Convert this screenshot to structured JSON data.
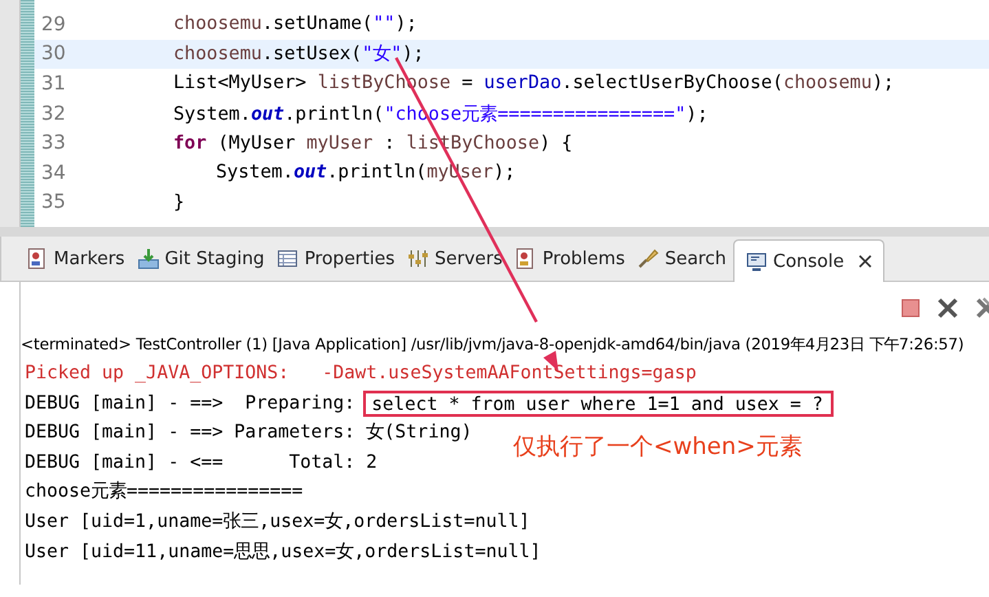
{
  "editor": {
    "lines": [
      {
        "number": "29",
        "current": false,
        "tokens": [
          {
            "kind": "var",
            "text": "choosemu"
          },
          {
            "kind": "plain",
            "text": ".setUname("
          },
          {
            "kind": "string",
            "text": "\"\""
          },
          {
            "kind": "plain",
            "text": ");"
          }
        ]
      },
      {
        "number": "30",
        "current": true,
        "tokens": [
          {
            "kind": "var",
            "text": "choosemu"
          },
          {
            "kind": "plain",
            "text": ".setUsex("
          },
          {
            "kind": "string",
            "text": "\"女\""
          },
          {
            "kind": "plain",
            "text": ");"
          }
        ]
      },
      {
        "number": "31",
        "current": false,
        "tokens": [
          {
            "kind": "plain",
            "text": "List<MyUser> "
          },
          {
            "kind": "var",
            "text": "listByChoose"
          },
          {
            "kind": "plain",
            "text": " = "
          },
          {
            "kind": "field",
            "text": "userDao"
          },
          {
            "kind": "plain",
            "text": ".selectUserByChoose("
          },
          {
            "kind": "var",
            "text": "choosemu"
          },
          {
            "kind": "plain",
            "text": ");"
          }
        ]
      },
      {
        "number": "32",
        "current": false,
        "tokens": [
          {
            "kind": "plain",
            "text": "System."
          },
          {
            "kind": "static",
            "text": "out"
          },
          {
            "kind": "plain",
            "text": ".println("
          },
          {
            "kind": "string",
            "text": "\"choose元素================\""
          },
          {
            "kind": "plain",
            "text": ");"
          }
        ]
      },
      {
        "number": "33",
        "current": false,
        "tokens": [
          {
            "kind": "keyword",
            "text": "for"
          },
          {
            "kind": "plain",
            "text": " (MyUser "
          },
          {
            "kind": "var",
            "text": "myUser"
          },
          {
            "kind": "plain",
            "text": " : "
          },
          {
            "kind": "var",
            "text": "listByChoose"
          },
          {
            "kind": "plain",
            "text": ") {"
          }
        ],
        "children": [
          {
            "number": "34",
            "current": false,
            "tokens": [
              {
                "kind": "plain",
                "text": "System."
              },
              {
                "kind": "static",
                "text": "out"
              },
              {
                "kind": "plain",
                "text": ".println("
              },
              {
                "kind": "var",
                "text": "myUser"
              },
              {
                "kind": "plain",
                "text": ");"
              }
            ]
          }
        ]
      },
      {
        "number": "35",
        "current": false,
        "tokens": [
          {
            "kind": "plain",
            "text": "}"
          }
        ]
      }
    ]
  },
  "tabs": [
    {
      "label": "Markers",
      "selected": false
    },
    {
      "label": "Git Staging",
      "selected": false
    },
    {
      "label": "Properties",
      "selected": false
    },
    {
      "label": "Servers",
      "selected": false
    },
    {
      "label": "Problems",
      "selected": false
    },
    {
      "label": "Search",
      "selected": false
    },
    {
      "label": "Console",
      "selected": true
    }
  ],
  "console": {
    "status": "<terminated> TestController (1) [Java Application] /usr/lib/jvm/java-8-openjdk-amd64/bin/java (2019年4月23日 下午7:26:57)",
    "lines": [
      {
        "kind": "stderr",
        "text": "Picked up _JAVA_OPTIONS:   -Dawt.useSystemAAFontSettings=gasp"
      },
      {
        "kind": "stdout",
        "text": "DEBUG [main] - ==>  Preparing:",
        "boxed": "select * from user where 1=1 and usex = ?"
      },
      {
        "kind": "stdout",
        "text": "DEBUG [main] - ==> Parameters: 女(String)"
      },
      {
        "kind": "stdout",
        "text": "DEBUG [main] - <==      Total: 2"
      },
      {
        "kind": "stdout",
        "text": "choose元素================"
      },
      {
        "kind": "stdout",
        "text": "User [uid=1,uname=张三,usex=女,ordersList=null]"
      },
      {
        "kind": "stdout",
        "text": "User [uid=11,uname=思思,usex=女,ordersList=null]"
      }
    ],
    "annotation": "仅执行了一个<when>元素"
  }
}
